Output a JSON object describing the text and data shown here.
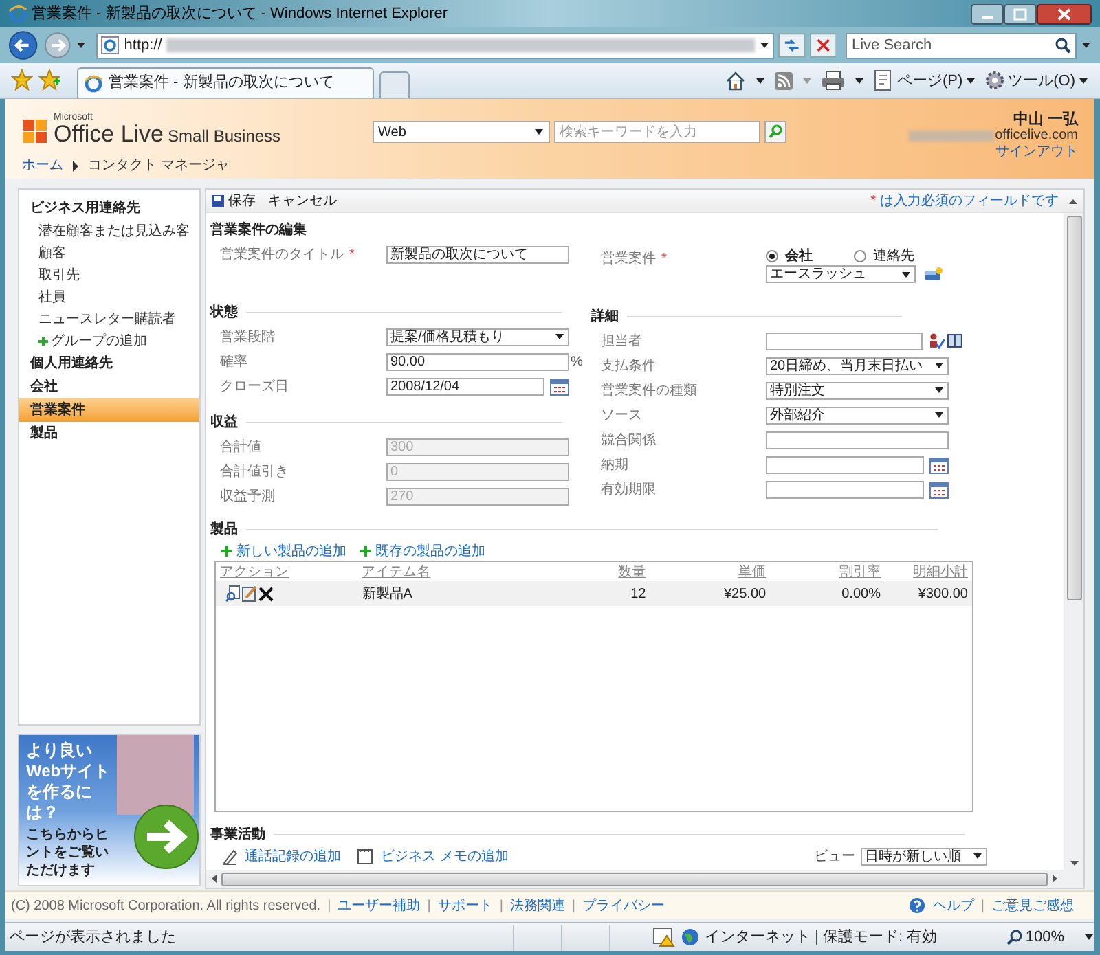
{
  "window": {
    "title": "営業案件 - 新製品の取次について - Windows Internet Explorer"
  },
  "address": {
    "url": "http://",
    "search_placeholder": "Live Search"
  },
  "tab": {
    "label": "営業案件 - 新製品の取次について"
  },
  "commands": [
    {
      "label": "ページ(P)",
      "kind": "page"
    },
    {
      "label": "ツール(O)",
      "kind": "tools"
    }
  ],
  "header": {
    "logo_brand": "Microsoft",
    "logo_main": "Office Live",
    "logo_sub": "Small Business",
    "search_scope": "Web",
    "search_placeholder": "検索キーワードを入力",
    "user_name": "中山 一弘",
    "user_domain": "officelive.com",
    "sign_out": "サインアウト",
    "breadcrumb": [
      "ホーム",
      "コンタクト マネージャ"
    ]
  },
  "sidebar": {
    "items": [
      {
        "label": "ビジネス用連絡先",
        "kind": "header",
        "selected": false
      },
      {
        "label": "潜在顧客または見込み客",
        "kind": "sub",
        "selected": false
      },
      {
        "label": "顧客",
        "kind": "sub",
        "selected": false
      },
      {
        "label": "取引先",
        "kind": "sub",
        "selected": false
      },
      {
        "label": "社員",
        "kind": "sub",
        "selected": false
      },
      {
        "label": "ニュースレター購読者",
        "kind": "sub",
        "selected": false
      },
      {
        "label": "グループの追加",
        "kind": "add",
        "selected": false
      },
      {
        "label": "個人用連絡先",
        "kind": "header",
        "selected": false
      },
      {
        "label": "会社",
        "kind": "header",
        "selected": false
      },
      {
        "label": "営業案件",
        "kind": "header",
        "selected": true
      },
      {
        "label": "製品",
        "kind": "header",
        "selected": false
      }
    ]
  },
  "ad": {
    "headline": "より良いWebサイトを作るには？",
    "body": "こちらからヒントをご覧いただけます"
  },
  "toolbar": {
    "save": "保存",
    "cancel": "キャンセル",
    "required_mark": "*",
    "required_note": "は入力必須のフィールドです"
  },
  "form": {
    "title": "営業案件の編集",
    "title_field": {
      "label": "営業案件のタイトル",
      "kind": "text",
      "value": "新製品の取次について",
      "required": true,
      "disabled": false
    },
    "account": {
      "label": "営業案件",
      "required": true,
      "options": [
        {
          "label": "会社",
          "selected": true
        },
        {
          "label": "連絡先",
          "selected": false
        }
      ],
      "value": "エースラッシュ"
    },
    "status": {
      "heading": "状態",
      "fields": [
        {
          "label": "営業段階",
          "kind": "select",
          "value": "提案/価格見積もり",
          "required": false,
          "disabled": false
        },
        {
          "label": "確率",
          "kind": "text",
          "value": "90.00",
          "suffix": "%",
          "required": false,
          "disabled": false
        },
        {
          "label": "クローズ日",
          "kind": "date",
          "value": "2008/12/04",
          "required": false,
          "disabled": false
        }
      ]
    },
    "revenue": {
      "heading": "収益",
      "fields": [
        {
          "label": "合計値",
          "kind": "text",
          "value": "300",
          "required": false,
          "disabled": true
        },
        {
          "label": "合計値引き",
          "kind": "text",
          "value": "0",
          "required": false,
          "disabled": true
        },
        {
          "label": "収益予測",
          "kind": "text",
          "value": "270",
          "required": false,
          "disabled": true
        }
      ]
    },
    "details": {
      "heading": "詳細",
      "fields": [
        {
          "label": "担当者",
          "kind": "people",
          "required": false,
          "disabled": false
        },
        {
          "label": "支払条件",
          "kind": "select",
          "value": "20日締め、当月末日払い",
          "required": false,
          "disabled": false
        },
        {
          "label": "営業案件の種類",
          "kind": "select",
          "value": "特別注文",
          "required": false,
          "disabled": false
        },
        {
          "label": "ソース",
          "kind": "select",
          "value": "外部紹介",
          "required": false,
          "disabled": false
        },
        {
          "label": "競合関係",
          "kind": "text",
          "required": false,
          "disabled": false
        },
        {
          "label": "納期",
          "kind": "date",
          "required": false,
          "disabled": false
        },
        {
          "label": "有効期限",
          "kind": "date",
          "required": false,
          "disabled": false
        }
      ]
    }
  },
  "products": {
    "heading": "製品",
    "links": [
      "新しい製品の追加",
      "既存の製品の追加"
    ],
    "columns": [
      "アクション",
      "アイテム名",
      "数量",
      "単価",
      "割引率",
      "明細小計"
    ],
    "rows": [
      {
        "cells": [
          "",
          "新製品A",
          "12",
          "¥25.00",
          "0.00%",
          "¥300.00"
        ]
      }
    ]
  },
  "activities": {
    "heading": "事業活動",
    "links": [
      {
        "label": "通話記録の追加",
        "kind": "call"
      },
      {
        "label": "ビジネス メモの追加",
        "kind": "memo"
      }
    ],
    "view_label": "ビュー",
    "view_value": "日時が新しい順"
  },
  "footer": {
    "separator": "|",
    "copyright": "(C) 2008 Microsoft Corporation. All rights reserved.",
    "links": [
      "ユーザー補助",
      "サポート",
      "法務関連",
      "プライバシー"
    ],
    "right_links": [
      "ヘルプ",
      "ご意見ご感想"
    ]
  },
  "status_bar": {
    "message": "ページが表示されました",
    "zone": "インターネット | 保護モード: 有効",
    "zoom": "100%"
  }
}
